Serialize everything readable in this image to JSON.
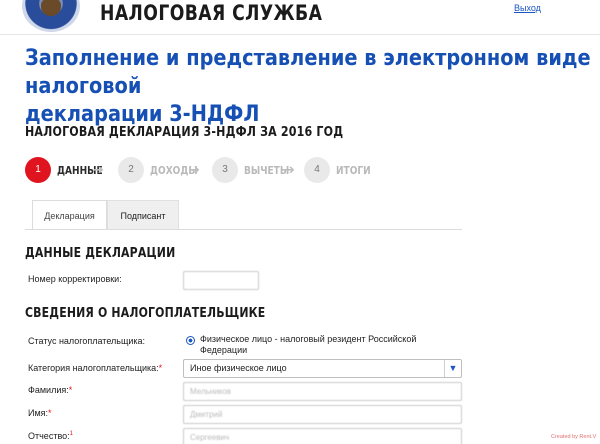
{
  "header": {
    "site_title": "НАЛОГОВАЯ СЛУЖБА",
    "logout_label": "Выход"
  },
  "page": {
    "title_line1": "Заполнение и представление в электронном виде налоговой",
    "title_line2": "декларации 3-НДФЛ",
    "declaration_title": "НАЛОГОВАЯ ДЕКЛАРАЦИЯ 3-НДФЛ ЗА 2016 ГОД"
  },
  "steps": [
    {
      "number": "1",
      "label": "ДАННЫЕ",
      "active": true
    },
    {
      "number": "2",
      "label": "ДОХОДЫ",
      "active": false
    },
    {
      "number": "3",
      "label": "ВЫЧЕТЫ",
      "active": false
    },
    {
      "number": "4",
      "label": "ИТОГИ",
      "active": false
    }
  ],
  "tabs": [
    {
      "label": "Декларация",
      "active": true
    },
    {
      "label": "Подписант",
      "active": false
    }
  ],
  "sections": {
    "declaration_data": "ДАННЫЕ ДЕКЛАРАЦИИ",
    "taxpayer_info": "СВЕДЕНИЯ О НАЛОГОПЛАТЕЛЬЩИКЕ"
  },
  "form": {
    "correction_label": "Номер корректировки:",
    "correction_value": "",
    "status_label": "Статус налогоплательщика:",
    "status_option": "Физическое лицо - налоговый резидент Российской Федерации",
    "category_label": "Категория налогоплательщика:",
    "category_value": "Иное физическое лицо",
    "surname_label": "Фамилия:",
    "surname_value": "Мельников",
    "name_label": "Имя:",
    "name_value": "Дмитрий",
    "patronymic_label": "Отчество:",
    "patronymic_value": "Сергеевич",
    "required_mark": "*",
    "patronymic_mark": "1"
  },
  "footer": {
    "credit": "Created by Rent.V"
  },
  "colors": {
    "accent_blue": "#1650b4",
    "active_red": "#e0141e"
  }
}
